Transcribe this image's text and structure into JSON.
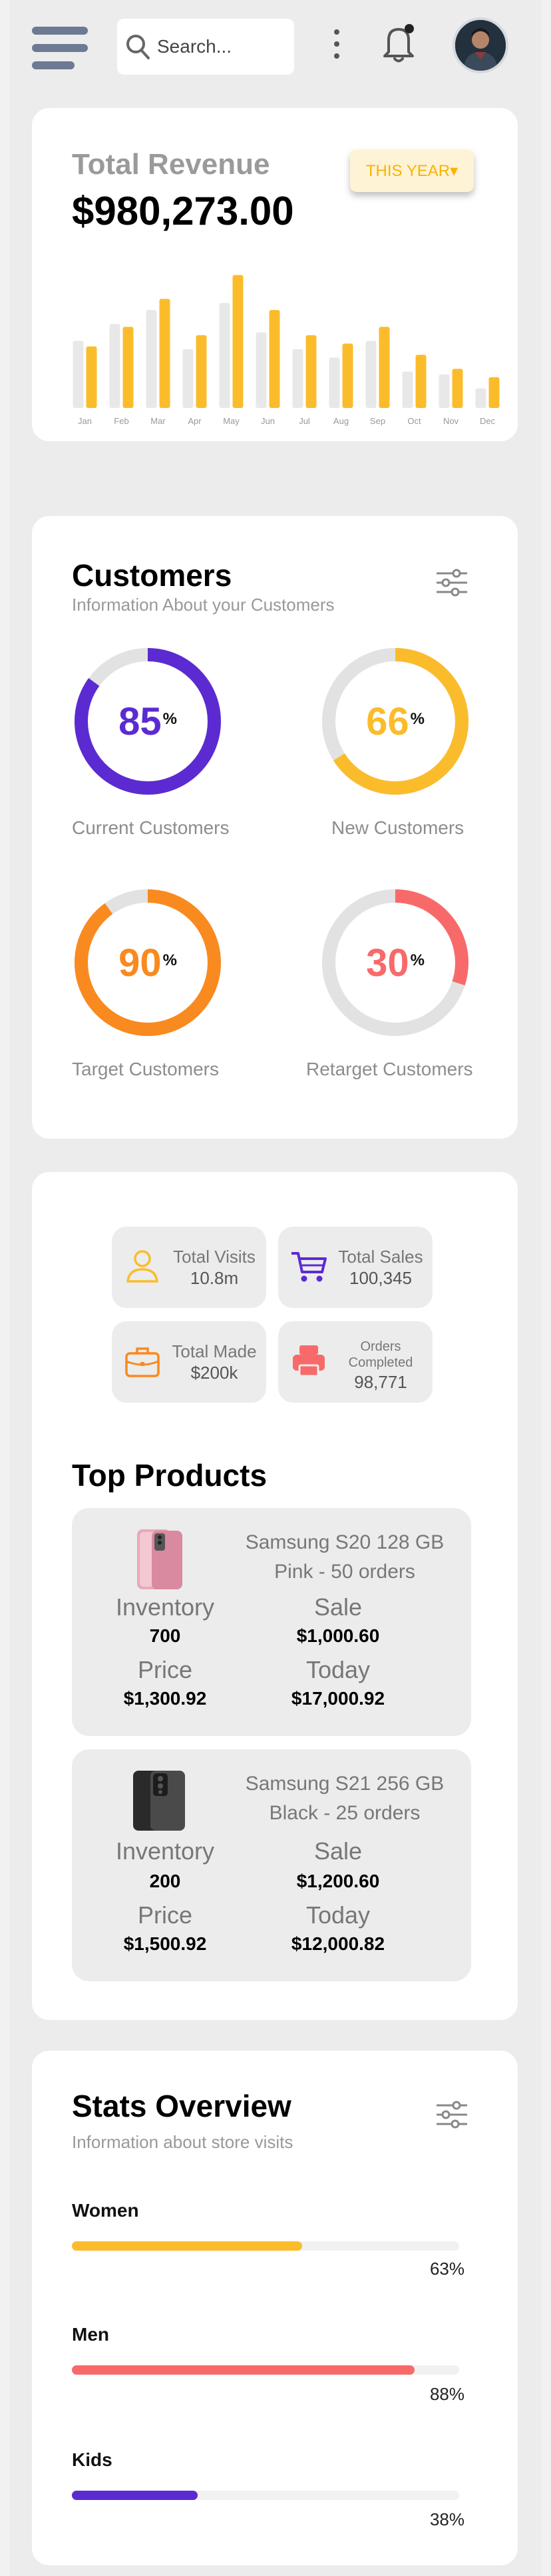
{
  "header": {
    "search_placeholder": "Search..."
  },
  "revenue": {
    "title": "Total Revenue",
    "amount": "$980,273.00",
    "period_button": "THIS YEAR▾",
    "chart_data": {
      "type": "bar",
      "categories": [
        "Jan",
        "Feb",
        "Mar",
        "Apr",
        "May",
        "Jun",
        "Jul",
        "Aug",
        "Sep",
        "Oct",
        "Nov",
        "Dec"
      ],
      "series": [
        {
          "color": "#e8e8e8",
          "values": [
            48,
            60,
            70,
            42,
            75,
            54,
            42,
            36,
            48,
            26,
            24,
            14
          ]
        },
        {
          "color": "#fbbc2c",
          "values": [
            44,
            58,
            78,
            52,
            95,
            70,
            52,
            46,
            58,
            38,
            28,
            22
          ]
        }
      ],
      "ylim": [
        0,
        100
      ]
    },
    "colors": {
      "primary": "#fbbc2c",
      "secondary": "#e8e8e8"
    }
  },
  "customers": {
    "title": "Customers",
    "subtitle": "Information About your Customers",
    "items": [
      {
        "value": "85",
        "pct_symbol": "%",
        "label": "Current Customers",
        "percent": 85,
        "color": "#5b2bd1"
      },
      {
        "value": "66",
        "pct_symbol": "%",
        "label": "New Customers",
        "percent": 66,
        "color": "#fbbc2c"
      },
      {
        "value": "90",
        "pct_symbol": "%",
        "label": "Target Customers",
        "percent": 90,
        "color": "#f98a1f"
      },
      {
        "value": "30",
        "pct_symbol": "%",
        "label": "Retarget Customers",
        "percent": 30,
        "color": "#f86a6a"
      }
    ]
  },
  "summary_tiles": [
    {
      "label": "Total Visits",
      "value": "10.8m",
      "icon": "user-icon"
    },
    {
      "label": "Total Sales",
      "value": "100,345",
      "icon": "cart-icon"
    },
    {
      "label": "Total Made",
      "value": "$200k",
      "icon": "briefcase-icon"
    },
    {
      "label": "Orders Completed",
      "value": "98,771",
      "icon": "printer-icon"
    }
  ],
  "top_products": {
    "title": "Top Products",
    "items": [
      {
        "name": "Samsung S20 128 GB",
        "detail": "Pink - 50 orders",
        "inventory_label": "Inventory",
        "inventory": "700",
        "sale_label": "Sale",
        "sale": "$1,000.60",
        "price_label": "Price",
        "price": "$1,300.92",
        "today_label": "Today",
        "today": "$17,000.92",
        "image": "pink-phone"
      },
      {
        "name": "Samsung S21 256 GB",
        "detail": "Black - 25 orders",
        "inventory_label": "Inventory",
        "inventory": "200",
        "sale_label": "Sale",
        "sale": "$1,200.60",
        "price_label": "Price",
        "price": "$1,500.92",
        "today_label": "Today",
        "today": "$12,000.82",
        "image": "black-phone"
      }
    ]
  },
  "stats": {
    "title": "Stats Overview",
    "subtitle": "Information about store visits",
    "items": [
      {
        "label": "Women",
        "percent_text": "63%",
        "fill": 0.595,
        "color": "#fbbc2c"
      },
      {
        "label": "Men",
        "percent_text": "88%",
        "fill": 0.885,
        "color": "#f86a6a"
      },
      {
        "label": "Kids",
        "percent_text": "38%",
        "fill": 0.325,
        "color": "#5b2bd1"
      }
    ]
  }
}
